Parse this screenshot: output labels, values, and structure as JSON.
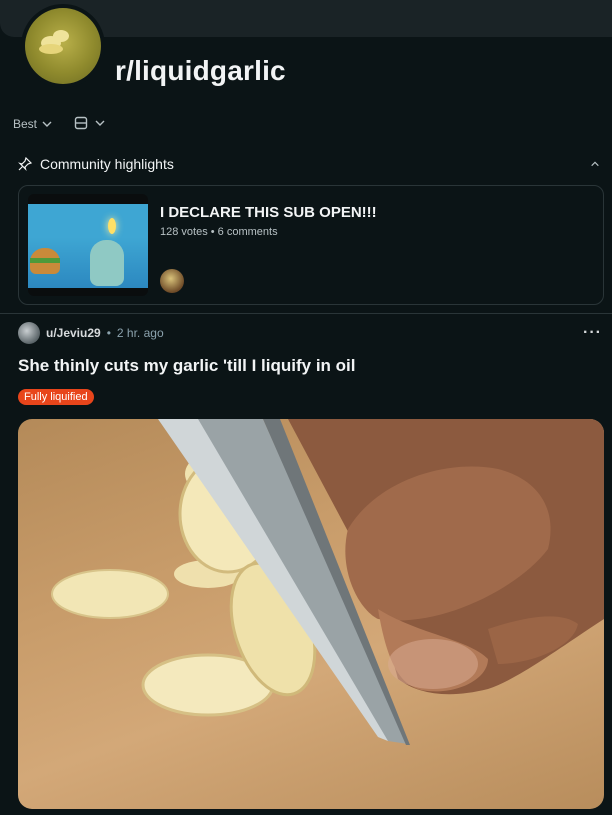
{
  "subreddit": {
    "name": "r/liquidgarlic"
  },
  "controls": {
    "sort_label": "Best"
  },
  "highlights": {
    "heading": "Community highlights",
    "card": {
      "title": "I DECLARE THIS SUB OPEN!!!",
      "meta": "128 votes • 6 comments"
    }
  },
  "post": {
    "author": "u/Jeviu29",
    "separator": "•",
    "time": "2 hr. ago",
    "title": "She thinly cuts my garlic 'till I liquify in oil",
    "flair": "Fully liquified",
    "flair_color": "#e8451b",
    "more_label": "···"
  },
  "icons": {
    "sort": "chevron-down-icon",
    "layout": "card-layout-icon",
    "highlights": "pin-icon",
    "collapse": "chevron-up-icon",
    "more": "ellipsis-icon"
  },
  "colors": {
    "background": "#0b1416",
    "border": "#2a3538",
    "muted": "#b7c1c4"
  }
}
